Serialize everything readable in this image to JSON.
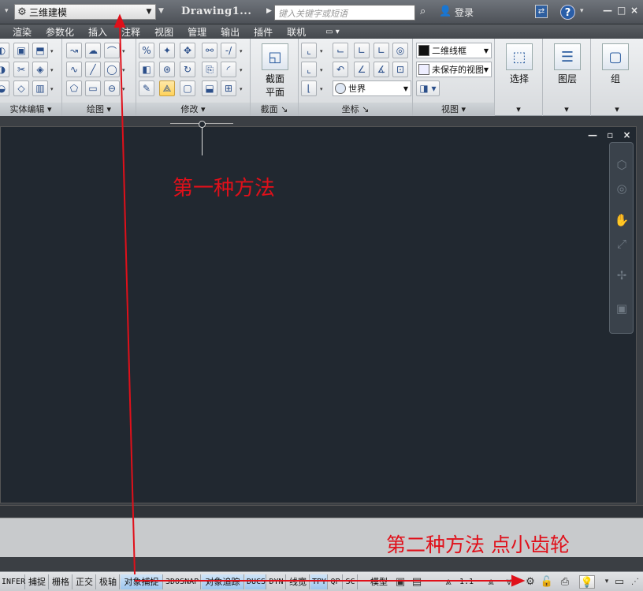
{
  "titlebar": {
    "workspace": "三维建模",
    "doc_title": "Drawing1...",
    "search_placeholder": "键入关键字或短语",
    "login": "登录",
    "help": "?",
    "min": "—",
    "max": "□",
    "close": "×"
  },
  "menu": [
    "渲染",
    "参数化",
    "插入",
    "注释",
    "视图",
    "管理",
    "输出",
    "插件",
    "联机"
  ],
  "ribbon": {
    "panels": {
      "solid_edit": "实体编辑",
      "draw": "绘图",
      "modify": "修改",
      "section": "截面",
      "coordinates": "坐标",
      "view": "视图"
    },
    "section_plane": [
      "截面",
      "平面"
    ],
    "visual_style": "二维线框",
    "saved_view": "未保存的视图",
    "ucs_world": "世界",
    "select": "选择",
    "layers": "图层",
    "group": "组"
  },
  "canvas": {
    "ctrl_min": "—",
    "ctrl_restore": "▫",
    "ctrl_close": "×"
  },
  "statusbar": {
    "items": [
      "INFER",
      "捕捉",
      "栅格",
      "正交",
      "极轴",
      "对象捕捉",
      "3DOSNAP",
      "对象追踪",
      "DUCS",
      "DYN",
      "线宽",
      "TPY",
      "QP",
      "SC"
    ],
    "model": "模型",
    "scale": "1:1"
  },
  "annotations": {
    "method1": "第一种方法",
    "method2": "第二种方法 点小齿轮"
  },
  "colors": {
    "annotation": "#e0101a",
    "canvas": "#212830"
  }
}
